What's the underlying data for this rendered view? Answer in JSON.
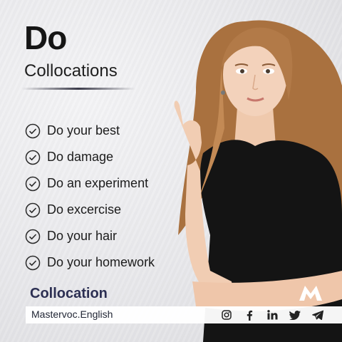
{
  "header": {
    "title": "Do",
    "subtitle": "Collocations"
  },
  "list": {
    "items": [
      "Do your best",
      "Do damage",
      "Do an experiment",
      "Do excercise",
      "Do your hair",
      "Do your homework"
    ]
  },
  "footer": {
    "brand_label": "Collocation",
    "site": "Mastervoc.English",
    "logo_letter": "M",
    "socials": [
      "instagram-icon",
      "facebook-icon",
      "linkedin-icon",
      "twitter-icon",
      "telegram-icon"
    ]
  },
  "colors": {
    "background": "#e9e9ec",
    "text": "#1c1c1c",
    "brand": "#2c2f52",
    "shirt": "#141414",
    "hair": "#b07a4a"
  }
}
